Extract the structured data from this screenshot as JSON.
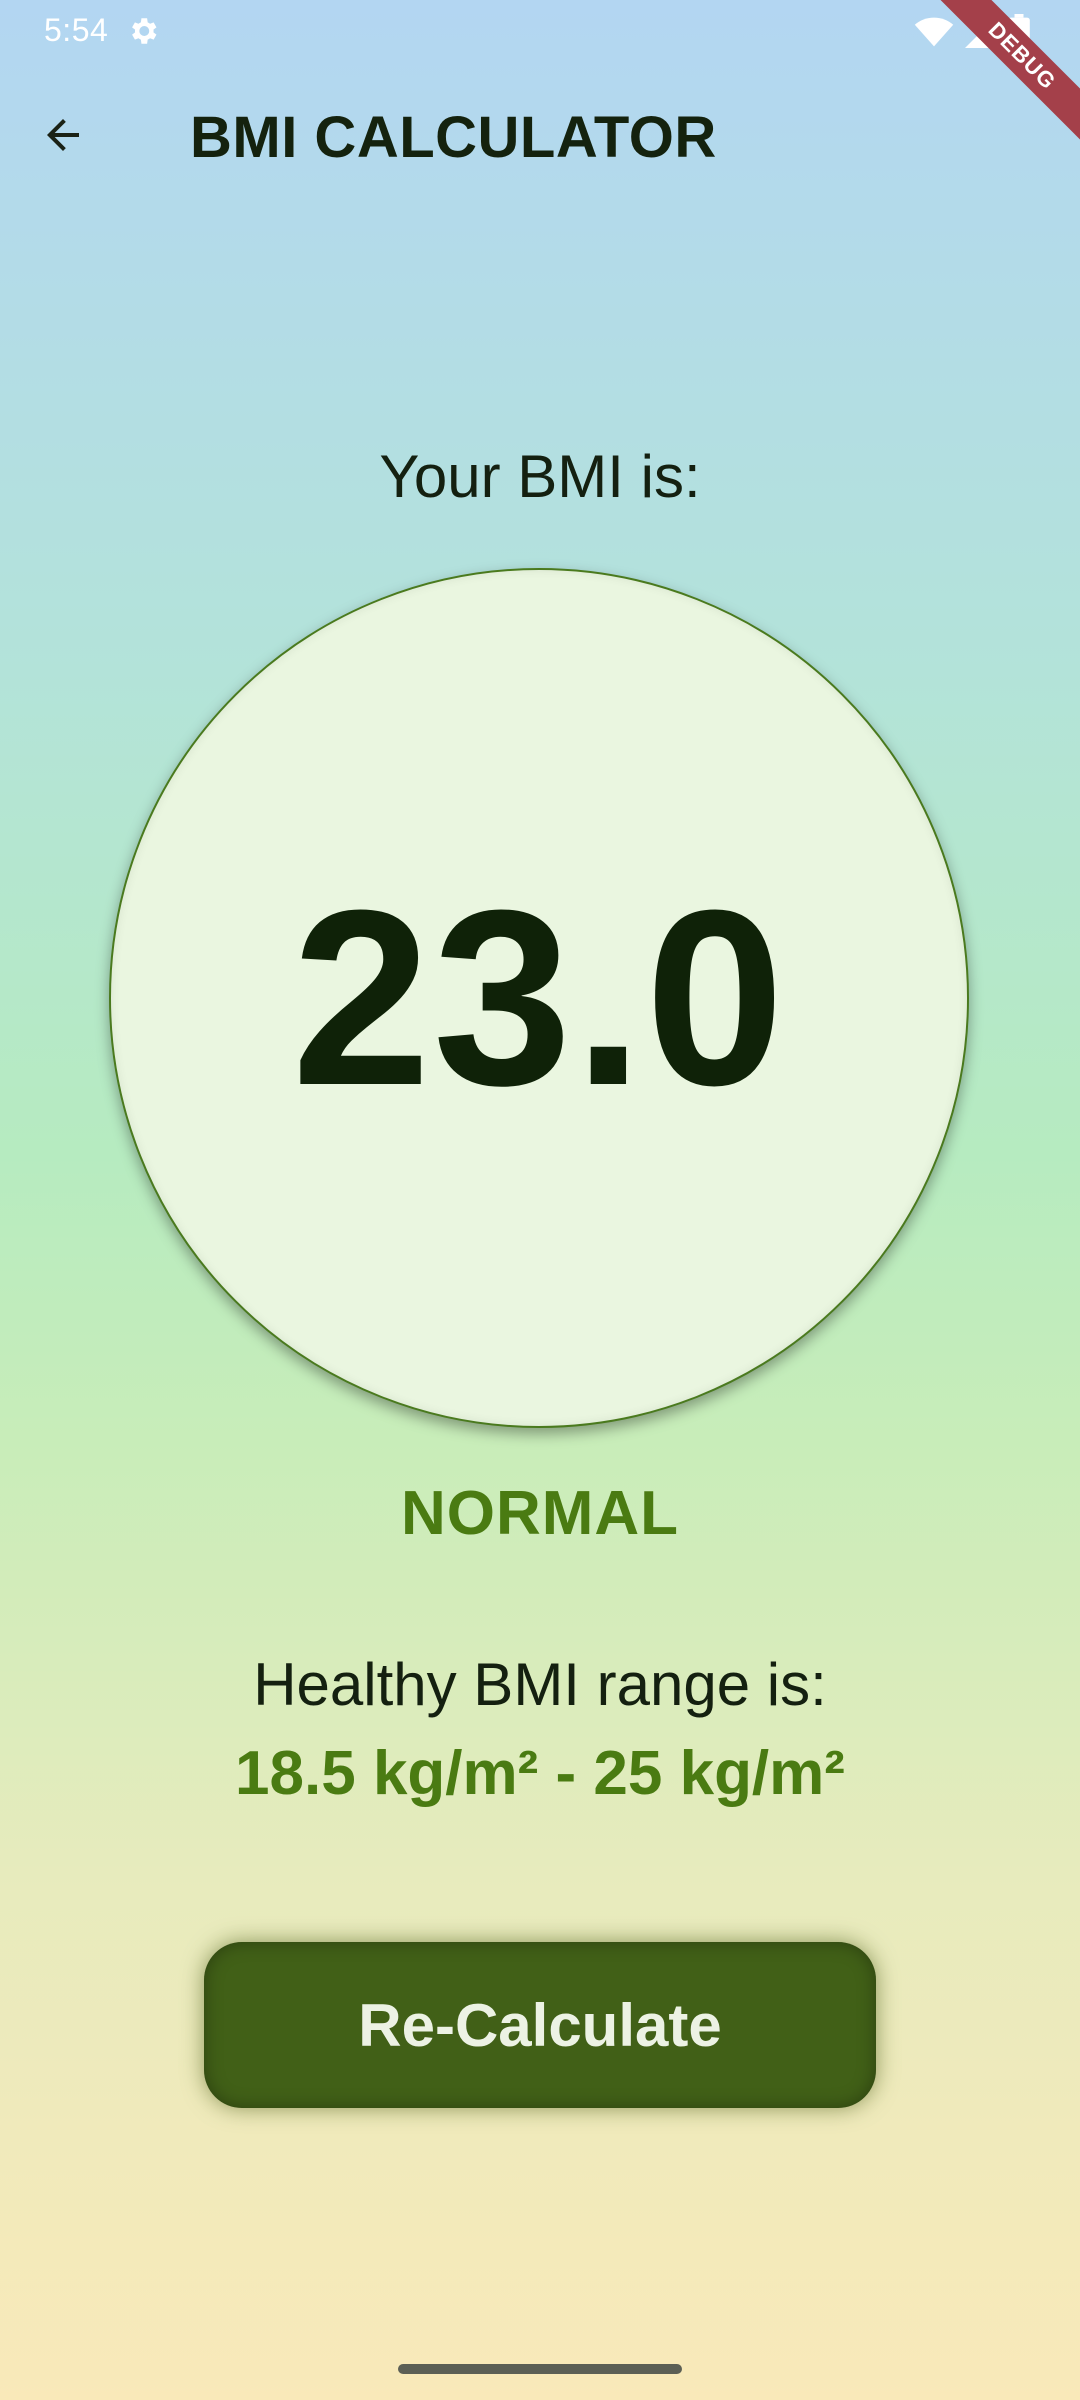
{
  "status_bar": {
    "time": "5:54",
    "icons": [
      "settings-icon",
      "wifi-icon",
      "signal-icon",
      "battery-icon"
    ]
  },
  "debug_banner": "DEBUG",
  "app_bar": {
    "back_icon": "arrow-back-icon",
    "title": "BMI CALCULATOR"
  },
  "result": {
    "label": "Your BMI is:",
    "value": "23.0",
    "status": "NORMAL"
  },
  "range": {
    "label": "Healthy BMI range is:",
    "value": "18.5 kg/m² - 25 kg/m²"
  },
  "actions": {
    "recalculate_label": "Re-Calculate"
  },
  "colors": {
    "accent_green": "#4a7b12",
    "button_green": "#416017",
    "circle_fill": "#eaf6e0",
    "text_dark": "#142010"
  }
}
